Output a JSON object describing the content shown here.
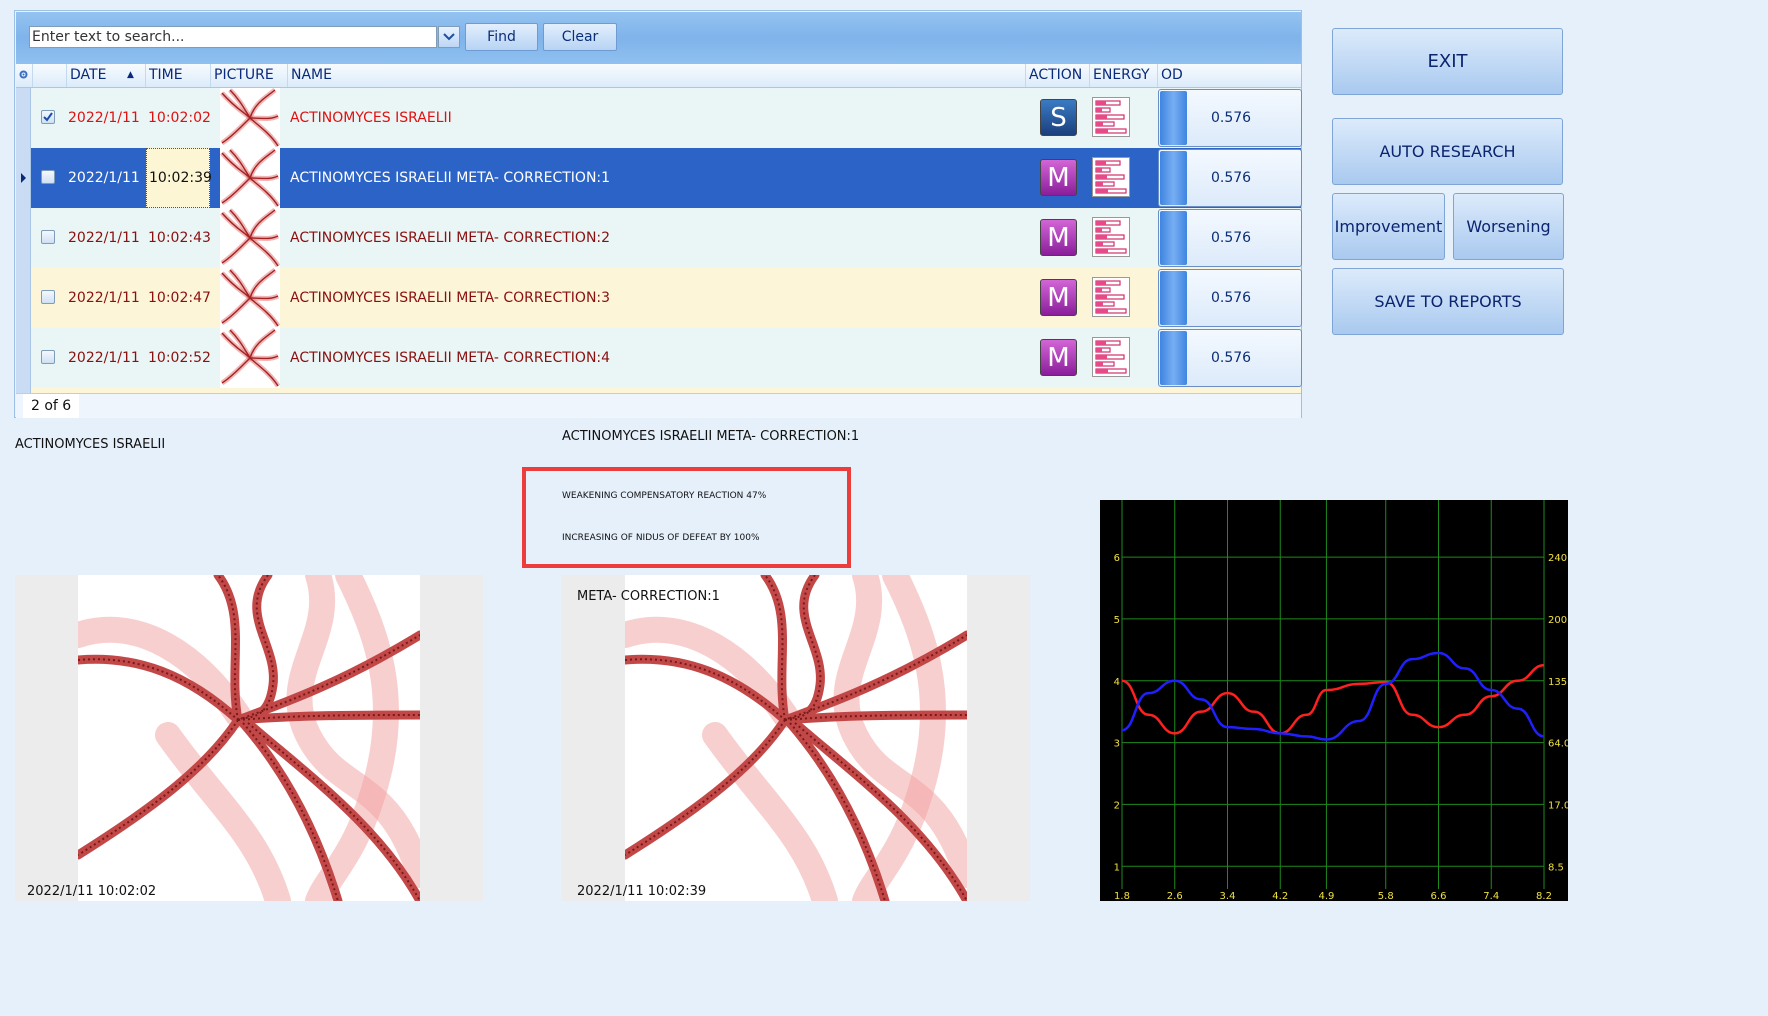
{
  "search": {
    "placeholder": "Enter text to search...",
    "find_label": "Find",
    "clear_label": "Clear"
  },
  "columns": {
    "date": "DATE",
    "time": "TIME",
    "picture": "PICTURE",
    "name": "NAME",
    "action": "ACTION",
    "energy": "ENERGY",
    "od": "OD"
  },
  "rows": [
    {
      "date": "2022/1/11",
      "time": "10:02:02",
      "name": "ACTINOMYCES  ISRAELII",
      "action": "S",
      "od": "0.576",
      "checked": true
    },
    {
      "date": "2022/1/11",
      "time": "10:02:39",
      "name": "ACTINOMYCES  ISRAELII META- CORRECTION:1",
      "action": "M",
      "od": "0.576",
      "checked": false,
      "selected": true
    },
    {
      "date": "2022/1/11",
      "time": "10:02:43",
      "name": "ACTINOMYCES  ISRAELII META- CORRECTION:2",
      "action": "M",
      "od": "0.576",
      "checked": false
    },
    {
      "date": "2022/1/11",
      "time": "10:02:47",
      "name": "ACTINOMYCES  ISRAELII META- CORRECTION:3",
      "action": "M",
      "od": "0.576",
      "checked": false
    },
    {
      "date": "2022/1/11",
      "time": "10:02:52",
      "name": "ACTINOMYCES  ISRAELII META- CORRECTION:4",
      "action": "M",
      "od": "0.576",
      "checked": false
    }
  ],
  "pager": {
    "text": "2 of 6"
  },
  "buttons": {
    "exit": "EXIT",
    "auto_research": "AUTO RESEARCH",
    "improvement": "Improvement",
    "worsening": "Worsening",
    "save_reports": "SAVE TO  REPORTS"
  },
  "left_title": "ACTINOMYCES  ISRAELII",
  "center_title": "ACTINOMYCES  ISRAELII META- CORRECTION:1",
  "results": [
    "WEAKENING COMPENSATORY REACTION 47%",
    "INCREASING OF NIDUS OF DEFEAT BY 100%"
  ],
  "image_left": {
    "timestamp": "2022/1/11 10:02:02"
  },
  "image_right": {
    "label": "META- CORRECTION:1",
    "timestamp": "2022/1/11 10:02:39"
  },
  "chart_data": {
    "type": "line",
    "x_ticks": [
      "1.8",
      "2.6",
      "3.4",
      "4.2",
      "4.9",
      "5.8",
      "6.6",
      "7.4",
      "8.2"
    ],
    "y_left_ticks": [
      "1",
      "2",
      "3",
      "4",
      "5",
      "6"
    ],
    "y_right_ticks": [
      "8.5",
      "17.0",
      "64.0",
      "135.0",
      "200.0",
      "240.0"
    ],
    "xlim": [
      1.8,
      8.2
    ],
    "ylim": [
      0.6,
      6.6
    ],
    "grid": true,
    "series": [
      {
        "color": "#ff2020",
        "x": [
          1.8,
          2.2,
          2.6,
          3.0,
          3.4,
          3.8,
          4.2,
          4.6,
          4.9,
          5.4,
          5.8,
          6.2,
          6.6,
          7.0,
          7.4,
          7.8,
          8.2
        ],
        "y": [
          4.0,
          3.45,
          3.15,
          3.5,
          3.8,
          3.5,
          3.15,
          3.45,
          3.85,
          3.95,
          3.98,
          3.45,
          3.25,
          3.45,
          3.75,
          4.0,
          4.25
        ]
      },
      {
        "color": "#2020ff",
        "x": [
          1.8,
          2.2,
          2.6,
          3.0,
          3.4,
          3.8,
          4.2,
          4.6,
          4.9,
          5.4,
          5.8,
          6.2,
          6.6,
          7.0,
          7.4,
          7.8,
          8.2
        ],
        "y": [
          3.2,
          3.8,
          4.0,
          3.7,
          3.25,
          3.22,
          3.15,
          3.1,
          3.05,
          3.35,
          3.95,
          4.35,
          4.45,
          4.2,
          3.85,
          3.55,
          3.1
        ]
      }
    ]
  }
}
